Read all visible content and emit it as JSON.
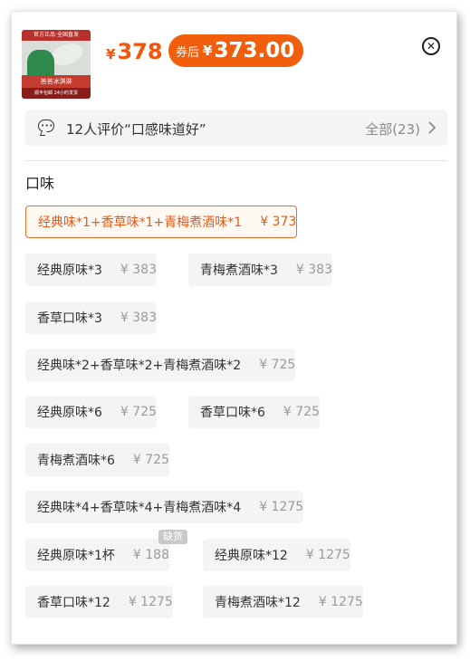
{
  "product": {
    "thumb_top_text": "官方正品·全国直发",
    "thumb_banner_text": "爸爸冰淇淋",
    "thumb_bottom_text": "顺丰包邮  24小时发货",
    "price_symbol": "¥",
    "price": "378",
    "coupon_label": "券后",
    "coupon_symbol": "¥",
    "coupon_price": "373.00"
  },
  "close_icon": "close-circle-icon",
  "reviews": {
    "icon": "chat-bubble-icon",
    "text": "12人评价“口感味道好”",
    "all_label": "全部(23)",
    "chevron_icon": "chevron-right-icon"
  },
  "section": {
    "title": "口味"
  },
  "options": [
    {
      "name": "经典味*1+香草味*1+青梅煮酒味*1",
      "price": "¥ 373",
      "selected": true
    },
    {
      "name": "经典原味*3",
      "price": "¥ 383"
    },
    {
      "name": "青梅煮酒味*3",
      "price": "¥ 383"
    },
    {
      "name": "香草口味*3",
      "price": "¥ 383"
    },
    {
      "name": "经典味*2+香草味*2+青梅煮酒味*2",
      "price": "¥ 725"
    },
    {
      "name": "经典原味*6",
      "price": "¥ 725"
    },
    {
      "name": "香草口味*6",
      "price": "¥ 725"
    },
    {
      "name": "青梅煮酒味*6",
      "price": "¥ 725"
    },
    {
      "name": "经典味*4+香草味*4+青梅煮酒味*4",
      "price": "¥ 1275"
    },
    {
      "name": "经典原味*1杯",
      "price": "¥ 188",
      "badge": "缺货"
    },
    {
      "name": "经典原味*12",
      "price": "¥ 1275"
    },
    {
      "name": "香草口味*12",
      "price": "¥ 1275"
    },
    {
      "name": "青梅煮酒味*12",
      "price": "¥ 1275"
    }
  ],
  "colors": {
    "accent": "#f25f0c",
    "selected_border": "#f06a28",
    "chip_bg": "#f4f4f4",
    "muted_text": "#9a9a9a",
    "badge_bg": "#c9c9c9"
  }
}
